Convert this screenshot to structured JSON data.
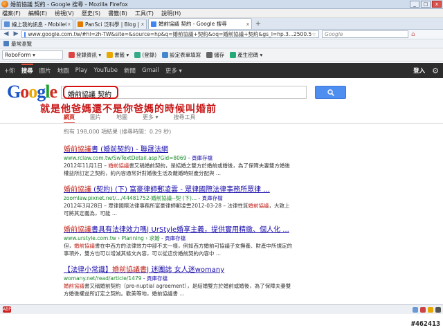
{
  "window": {
    "title": "婚前協議 契約 - Google 搜尋 - Mozilla Firefox",
    "min": "_",
    "max": "□",
    "close": "x"
  },
  "menu": [
    "檔案(F)",
    "編輯(E)",
    "檢視(V)",
    "歷史(S)",
    "書籤(B)",
    "工具(T)",
    "說明(H)"
  ],
  "tabs": [
    {
      "label": "線上我的訊息 - Mobile01",
      "fav": "#5b8fd6"
    },
    {
      "label": "PanSci 泛科學 | Blog | 比爾蓋茲的廚...",
      "fav": "#e07b00"
    },
    {
      "label": "婚前協議 契約 - Google 搜尋",
      "fav": "#4285f4"
    }
  ],
  "tab_close": "x",
  "new_tab": "+",
  "nav": {
    "back": "◀",
    "forward": "▶",
    "url": "www.google.com.tw/#hl=zh-TW&site=&source=hp&q=婚前協議+契約&oq=婚前協議+契約&gs_l=hp.3...2500.5",
    "search_placeholder": "Google",
    "star": "☆",
    "home": "⌂"
  },
  "bookmarks": {
    "label": "最常瀏覽"
  },
  "toolbar": {
    "roboform": "RoboForm ▾",
    "items": [
      {
        "label": "登錄資訊 ▾",
        "color": "#d44"
      },
      {
        "label": "書籤 ▾",
        "color": "#e9a800"
      },
      {
        "label": "(登錄)",
        "color": "#3a8"
      },
      {
        "label": "設定表單填寫",
        "color": "#48c"
      },
      {
        "label": "儲存",
        "color": "#666"
      },
      {
        "label": "產生密碼 ▾",
        "color": "#2a7"
      }
    ]
  },
  "gbar": {
    "items": [
      "+你",
      "搜尋",
      "圖片",
      "地圖",
      "Play",
      "YouTube",
      "新聞",
      "Gmail",
      "更多 ▾"
    ],
    "active": "搜尋",
    "signin": "登入",
    "gear": "⚙"
  },
  "search": {
    "query": "婚前協議 契約",
    "annotation": "就是他爸媽還不是你爸媽的時候叫婚前"
  },
  "result_tabs": [
    "網頁",
    "圖片",
    "地圖",
    "更多 ▾",
    "搜尋工具"
  ],
  "result_tab_active": "網頁",
  "stats": "約有 198,000 項結果 (搜尋時間：0.29 秒)",
  "results": [
    {
      "title_pre": "",
      "title_hl": "婚前協議",
      "title_post": "書 (婚前契約) - 聯晟法網",
      "url": "www.rclaw.com.tw/SwTextDetail.asp?Gid=8069",
      "cache": " - 頁庫存檔",
      "snippet_pre": "2012年11月1日 – ",
      "snippet_hl": "婚前協議",
      "snippet_post": "書又稱婚前契約，是結婚之雙方於婚前或婚後，為了保障夫妻雙方婚後權益所訂定之契約，約內容通常針對婚後生活及離婚時財產分配與 ..."
    },
    {
      "title_pre": "",
      "title_hl": "婚前協議",
      "title_post": " (契約) (下) 富豪律師郵凌雲 - 眾律國際法律事務所眾律 ...",
      "url": "zoomlaw.pixnet.net/.../44481752-婚前協議--契 (下)...",
      "cache": " - 頁庫存檔",
      "snippet_pre": "2012年3月28日 – 眾律國際法律事務所富豪律師郵凌雲2012-03-28 –  法律性質",
      "snippet_hl": "婚前協議",
      "snippet_post": "，大致上可將其定義為，可能 ..."
    },
    {
      "title_pre": "",
      "title_hl": "婚前協議",
      "title_post": "書具有法律效力嗎| UrStyle婚享主義，提供實用精緻、個人化 ...",
      "url": "www.urstyle.com.tw › Planning › 求婚",
      "cache": " - 頁庫存檔",
      "snippet_pre": "但，",
      "snippet_hl": "婚前協議",
      "snippet_post": "書在中西方的法律效力中卻不太一樣，例如西方婚前可協議子女撫養、財產中所規定的事項外，雙方也可以增減其條文內容，可以從這份婚前契約內容中 ..."
    },
    {
      "title_pre": "【法律小常識】",
      "title_hl": "婚前協議書",
      "title_post": "| 迷團誌 女人迷womany",
      "url": "womany.net/read/article/1479",
      "cache": " - 頁庫存檔",
      "snippet_pre": "",
      "snippet_hl": "婚前協議",
      "snippet_post": "書又稱婚前契約（pre-nuptial agreement），是結婚雙方於婚前或婚後，為了保障夫妻雙方婚後權益所訂定之契約。歡美等地，婚前協議書 ..."
    }
  ],
  "status": {
    "abp": "ABP"
  },
  "watermark": "#462413"
}
